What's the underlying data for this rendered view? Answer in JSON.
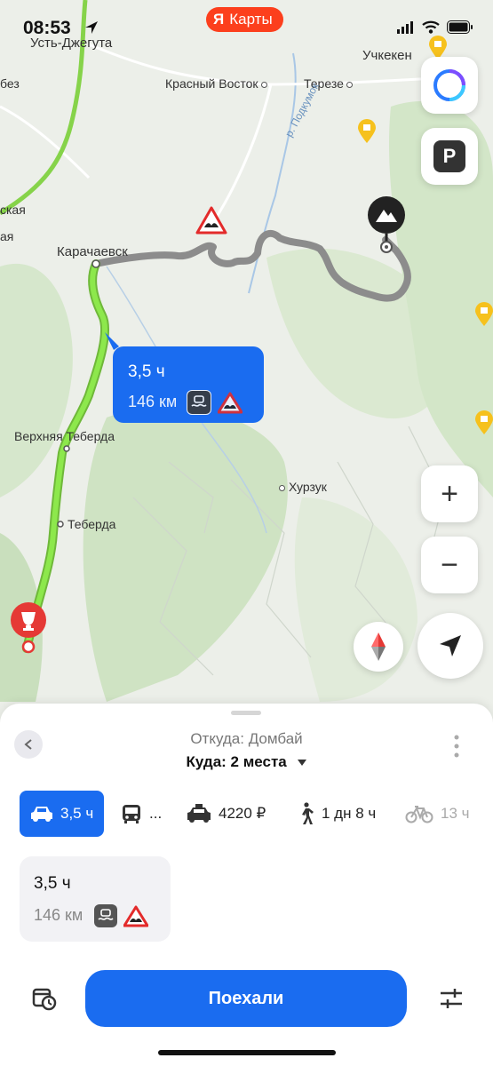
{
  "status_bar": {
    "time": "08:53"
  },
  "app": {
    "brand_letter": "Я",
    "brand_name": "Карты"
  },
  "map": {
    "places": [
      {
        "name": "Усть-Джегута"
      },
      {
        "name": "Красный Восток"
      },
      {
        "name": "Терезе"
      },
      {
        "name": "Учкекен"
      },
      {
        "name": "Карачаевск"
      },
      {
        "name": "Верхняя Теберда"
      },
      {
        "name": "Теберда"
      },
      {
        "name": "Хурзук"
      },
      {
        "name": "без"
      },
      {
        "name": "ская"
      },
      {
        "name": "ая"
      }
    ],
    "river_label": "р. Подкумок",
    "route_bubble": {
      "time": "3,5 ч",
      "distance": "146 км"
    },
    "colors": {
      "route_green": "#7be13a",
      "route_gray": "#8c8c8c",
      "accent": "#1a6cf0",
      "brand": "#fc3f1d"
    }
  },
  "controls": {
    "alice": "alice-icon",
    "parking": "P",
    "zoom_in": "+",
    "zoom_out": "−"
  },
  "sheet": {
    "from": "Откуда: Домбай",
    "to": "Куда: 2 места",
    "modes": [
      {
        "icon": "car-icon",
        "label": "3,5 ч",
        "active": true
      },
      {
        "icon": "bus-icon",
        "label": "..."
      },
      {
        "icon": "taxi-icon",
        "label": "4220 ₽"
      },
      {
        "icon": "walk-icon",
        "label": "1 дн 8 ч"
      },
      {
        "icon": "bike-icon",
        "label": "13 ч"
      }
    ],
    "route_card": {
      "time": "3,5 ч",
      "distance": "146 км"
    },
    "go_button": "Поехали"
  }
}
